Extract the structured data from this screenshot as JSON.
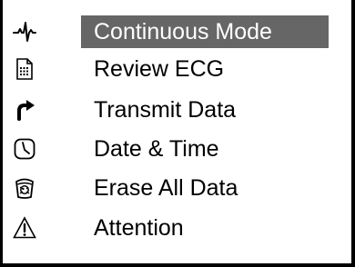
{
  "menu": {
    "selected_index": 0,
    "items": [
      {
        "label": "Continuous Mode",
        "icon": "ecg-waveform-icon"
      },
      {
        "label": "Review ECG",
        "icon": "document-icon"
      },
      {
        "label": "Transmit Data",
        "icon": "transmit-arrow-icon"
      },
      {
        "label": "Date & Time",
        "icon": "clock-icon"
      },
      {
        "label": "Erase All Data",
        "icon": "trash-icon"
      },
      {
        "label": "Attention",
        "icon": "warning-icon"
      }
    ]
  },
  "colors": {
    "highlight": "#666666",
    "text": "#000000",
    "selected_text": "#ffffff",
    "border": "#000000"
  }
}
